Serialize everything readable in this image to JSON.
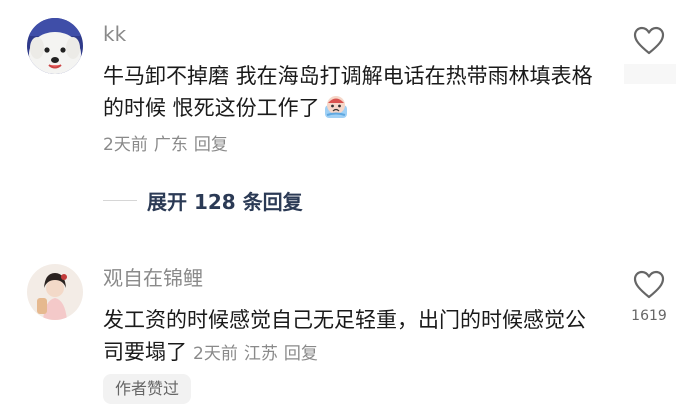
{
  "comments": [
    {
      "username": "kk",
      "text": "牛马卸不掉磨 我在海岛打调解电话在热带雨林填表格的时候 恨死这份工作了",
      "emoji": "crying-face-emoji",
      "time": "2天前",
      "location": "广东",
      "reply_label": "回复",
      "expand_label": "展开 128 条回复",
      "like_icon": "heart-outline-icon",
      "avatar": "white-dog-avatar"
    },
    {
      "username": "观自在锦鲤",
      "text": "发工资的时候感觉自己无足轻重，出门的时候感觉公司要塌了",
      "time": "2天前",
      "location": "江苏",
      "reply_label": "回复",
      "like_count": "1619",
      "like_icon": "heart-outline-icon",
      "badge": "作者赞过",
      "avatar": "costume-girl-avatar"
    }
  ],
  "colors": {
    "text": "#1a1a1a",
    "secondary": "#8a8a8a",
    "expand": "#2b3a55",
    "badge_bg": "#f2f2f2"
  }
}
